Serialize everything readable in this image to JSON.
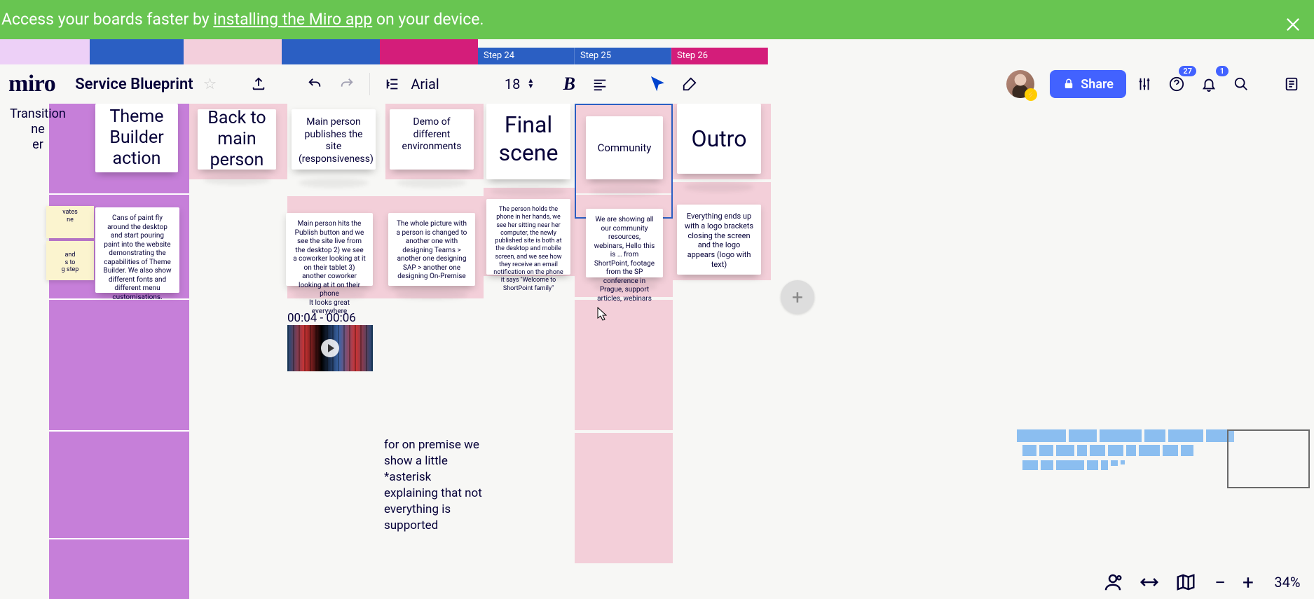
{
  "banner": {
    "prefix": "Access your boards faster by ",
    "link": "installing the Miro app",
    "suffix": " on your device."
  },
  "brand": "miro",
  "board_title": "Service Blueprint",
  "toolbar": {
    "font_name": "Arial",
    "font_size": "18",
    "share_label": "Share",
    "help_badge": "27",
    "notif_badge": "1"
  },
  "steps": {
    "s24": "Step 24",
    "s25": "Step 25",
    "s26": "Step 26"
  },
  "left_labels": {
    "transition": "Transition",
    "frag1": "ne",
    "frag2": "er",
    "yellow1a": "vates",
    "yellow1b": "ne",
    "yellow2a": "and",
    "yellow2b": "s to",
    "yellow2c": "g step"
  },
  "cards": {
    "theme_builder": "Theme\nBuilder\naction",
    "back_main": "Back to\nmain\nperson",
    "publish": "Main person publishes the site (responsiveness)",
    "demo_env": "Demo of different environments",
    "final_scene": "Final\nscene",
    "community": "Community",
    "outro": "Outro"
  },
  "desc": {
    "theme": "Cans of paint fly around the desktop and start pouring paint into the website demonstrating the capabilities of Theme Builder. We also show different fonts and different menu customisations.",
    "publish": "Main person hits the Publish button and we see the site live from the desktop 2) we see a coworker looking at it on their tablet 3) another coworker looking at it on their phone\n It looks great everywhere",
    "demo": "The whole picture with a person is changed to another one with designing Teams > another one designing SAP > another one designing On-Premise",
    "final": "The person holds the phone in her hands, we see her sitting near her computer, the newly published site is both at the desktop and mobile screen, and we see how they receive an email notification on the phone it says \"Welcome to ShortPoint family\"",
    "community": "We are showing all our community resources, webinars, Hello this is … from ShortPoint, footage from the SP conference in Prague, support articles, webinars",
    "outro": "Everything ends up with a logo brackets closing the screen and the logo appears (logo with text)"
  },
  "timecode": "00:04 - 00:06",
  "para": "for on premise we show a little *asterisk explaining that not everything is supported",
  "zoom": {
    "pct": "34%"
  }
}
